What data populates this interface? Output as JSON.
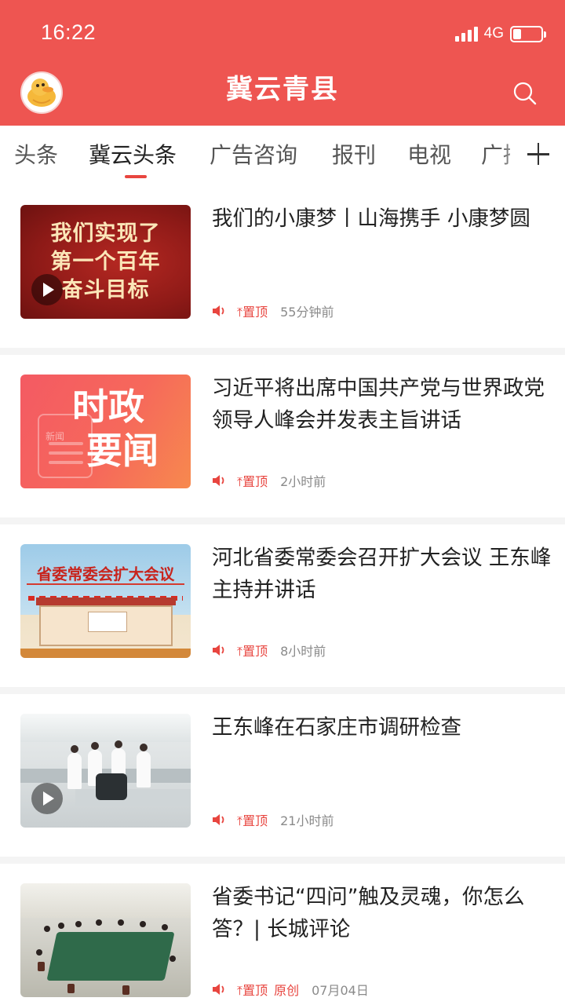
{
  "status_bar": {
    "time": "16:22",
    "network": "4G"
  },
  "header": {
    "title": "冀云青县"
  },
  "tabs": [
    {
      "label": "头条"
    },
    {
      "label": "冀云头条"
    },
    {
      "label": "广告咨询"
    },
    {
      "label": "报刊"
    },
    {
      "label": "电视"
    },
    {
      "label": "广播"
    }
  ],
  "active_tab": "冀云头条",
  "news": [
    {
      "title": "我们的小康梦丨山海携手 小康梦圆",
      "pin_label": "置顶",
      "time": "55分钟前",
      "thumb_text": [
        "我们实现了",
        "第一个百年",
        "奋斗目标"
      ],
      "has_video": true
    },
    {
      "title": "习近平将出席中国共产党与世界政党领导人峰会并发表主旨讲话",
      "pin_label": "置顶",
      "time": "2小时前",
      "thumb_text": [
        "时政",
        "要闻"
      ],
      "thumb_doc_label": "新闻"
    },
    {
      "title": "河北省委常委会召开扩大会议 王东峰主持并讲话",
      "pin_label": "置顶",
      "time": "8小时前",
      "thumb_text": [
        "省委常委会扩大会议"
      ]
    },
    {
      "title": "王东峰在石家庄市调研检查",
      "pin_label": "置顶",
      "time": "21小时前",
      "has_video": true
    },
    {
      "title": "省委书记“四问”触及灵魂，你怎么答？| 长城评论",
      "pin_label": "置顶",
      "original_label": "原创",
      "time": "07月04日"
    }
  ],
  "icons": {
    "search": "search-icon",
    "add_tab": "plus-icon",
    "speaker": "speaker-icon",
    "pin": "pin-arrow-icon",
    "play": "play-icon"
  },
  "colors": {
    "brand": "#ee5551",
    "accent": "#e8453f"
  }
}
